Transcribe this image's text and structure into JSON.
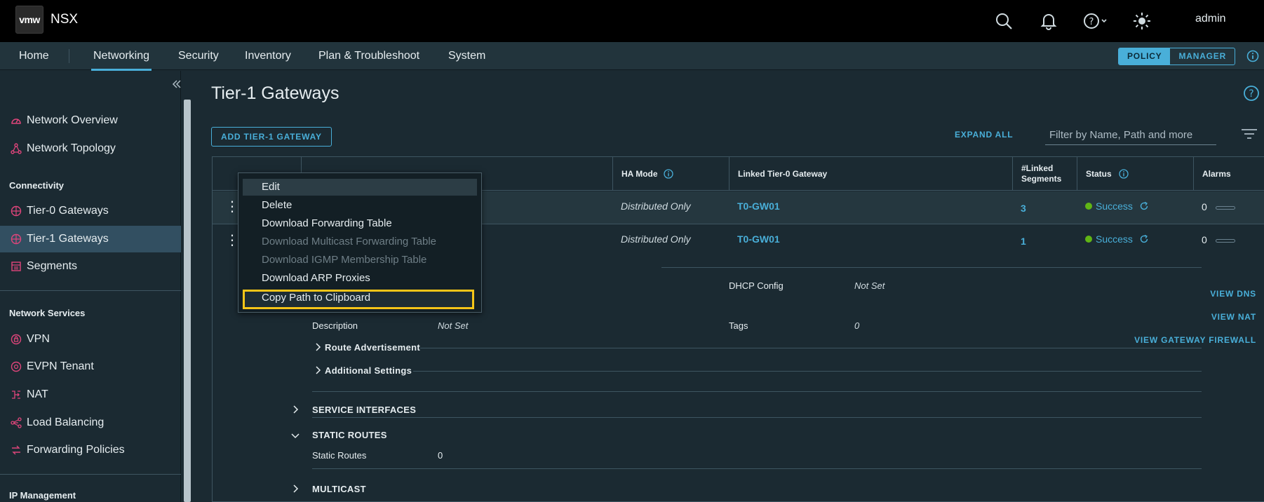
{
  "header": {
    "logo": "vmw",
    "app_name": "NSX",
    "user": "admin",
    "icons": [
      "search-icon",
      "bell-icon",
      "help-icon",
      "theme-sun-icon"
    ]
  },
  "nav": {
    "items": [
      "Home",
      "Networking",
      "Security",
      "Inventory",
      "Plan & Troubleshoot",
      "System"
    ],
    "active": "Networking",
    "mode_policy": "POLICY",
    "mode_manager": "MANAGER"
  },
  "sidebar": {
    "items": [
      {
        "label": "Network Overview",
        "icon": "gauge-icon"
      },
      {
        "label": "Network Topology",
        "icon": "topology-icon"
      }
    ],
    "connectivity_heading": "Connectivity",
    "connectivity": [
      {
        "label": "Tier-0 Gateways",
        "icon": "gateway-icon"
      },
      {
        "label": "Tier-1 Gateways",
        "icon": "gateway-icon"
      },
      {
        "label": "Segments",
        "icon": "segments-icon"
      }
    ],
    "services_heading": "Network Services",
    "services": [
      {
        "label": "VPN",
        "icon": "vpn-icon"
      },
      {
        "label": "EVPN Tenant",
        "icon": "evpn-icon"
      },
      {
        "label": "NAT",
        "icon": "nat-icon"
      },
      {
        "label": "Load Balancing",
        "icon": "load-balancer-icon"
      },
      {
        "label": "Forwarding Policies",
        "icon": "forwarding-icon"
      }
    ],
    "ip_heading": "IP Management"
  },
  "page": {
    "title": "Tier-1 Gateways",
    "add_button": "ADD TIER-1 GATEWAY",
    "expand_all": "EXPAND ALL",
    "filter_placeholder": "Filter by Name, Path and more"
  },
  "table": {
    "headers": {
      "ha_mode": "HA Mode",
      "linked_t0": "Linked Tier-0 Gateway",
      "linked_segments_1": "#Linked",
      "linked_segments_2": "Segments",
      "status": "Status",
      "alarms": "Alarms"
    },
    "rows": [
      {
        "ha_mode": "Distributed Only",
        "linked_t0": "T0-GW01",
        "segments": "3",
        "status": "Success",
        "alarms": "0"
      },
      {
        "ha_mode": "Distributed Only",
        "linked_t0": "T0-GW01",
        "segments": "1",
        "status": "Success",
        "alarms": "0"
      }
    ],
    "detail": {
      "dhcp_label": "DHCP Config",
      "dhcp_value": "Not Set",
      "description_label": "Description",
      "description_value": "Not Set",
      "tags_label": "Tags",
      "tags_value": "0",
      "route_adv": "Route Advertisement",
      "additional": "Additional Settings",
      "service_interfaces": "SERVICE INTERFACES",
      "static_routes": "STATIC ROUTES",
      "static_routes_label": "Static Routes",
      "static_routes_value": "0",
      "multicast": "MULTICAST",
      "view_dns": "VIEW DNS",
      "view_nat": "VIEW NAT",
      "view_firewall": "VIEW GATEWAY FIREWALL"
    }
  },
  "context_menu": {
    "items": [
      {
        "label": "Edit",
        "state": "hover"
      },
      {
        "label": "Delete",
        "state": "normal"
      },
      {
        "label": "Download Forwarding Table",
        "state": "normal"
      },
      {
        "label": "Download Multicast Forwarding Table",
        "state": "disabled"
      },
      {
        "label": "Download IGMP Membership Table",
        "state": "disabled"
      },
      {
        "label": "Download ARP Proxies",
        "state": "normal"
      },
      {
        "label": "Copy Path to Clipboard",
        "state": "highlighted"
      }
    ],
    "highlight_color": "#f5c518"
  },
  "colors": {
    "accent": "#49afd9",
    "success": "#60b515",
    "sidebar_icon": "#e0457b"
  }
}
